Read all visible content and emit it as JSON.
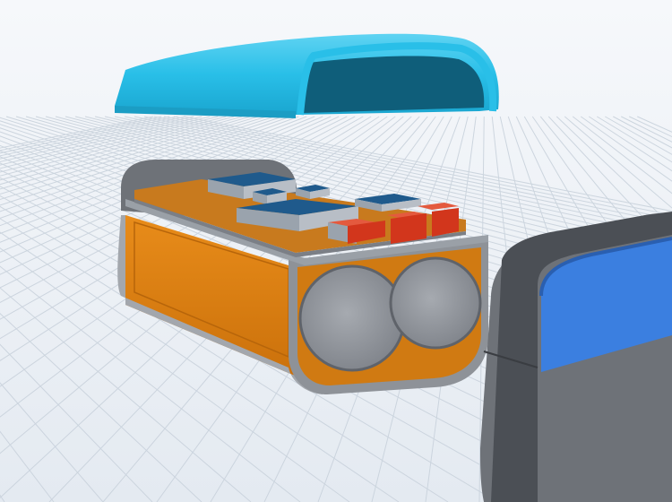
{
  "scene": {
    "colors": {
      "background_top": "#f6f8fb",
      "background_bottom": "#e4eaf1",
      "grid_line": "#c9d2dc",
      "lid": "#29bfe8",
      "lid_dark": "#1b9dc4",
      "lid_inner": "#0f5e7a",
      "body_shell": "#7b7f86",
      "body_shell_dark": "#55595f",
      "body_shell_light": "#a3a7ad",
      "battery_wrap": "#e0810f",
      "battery_wrap_dark": "#b7650a",
      "battery_cell": "#8d9198",
      "battery_cell_light": "#a6aab0",
      "pcb": "#c87a1e",
      "pcb_plate": "#9aa0a7",
      "chip_large": "#1f5a8c",
      "chip_light": "#9aa3ad",
      "component_red": "#d2361c",
      "end_cap": "#6e7278",
      "end_cap_dark": "#4b4f55",
      "end_cap_window": "#3b7fe0"
    }
  }
}
